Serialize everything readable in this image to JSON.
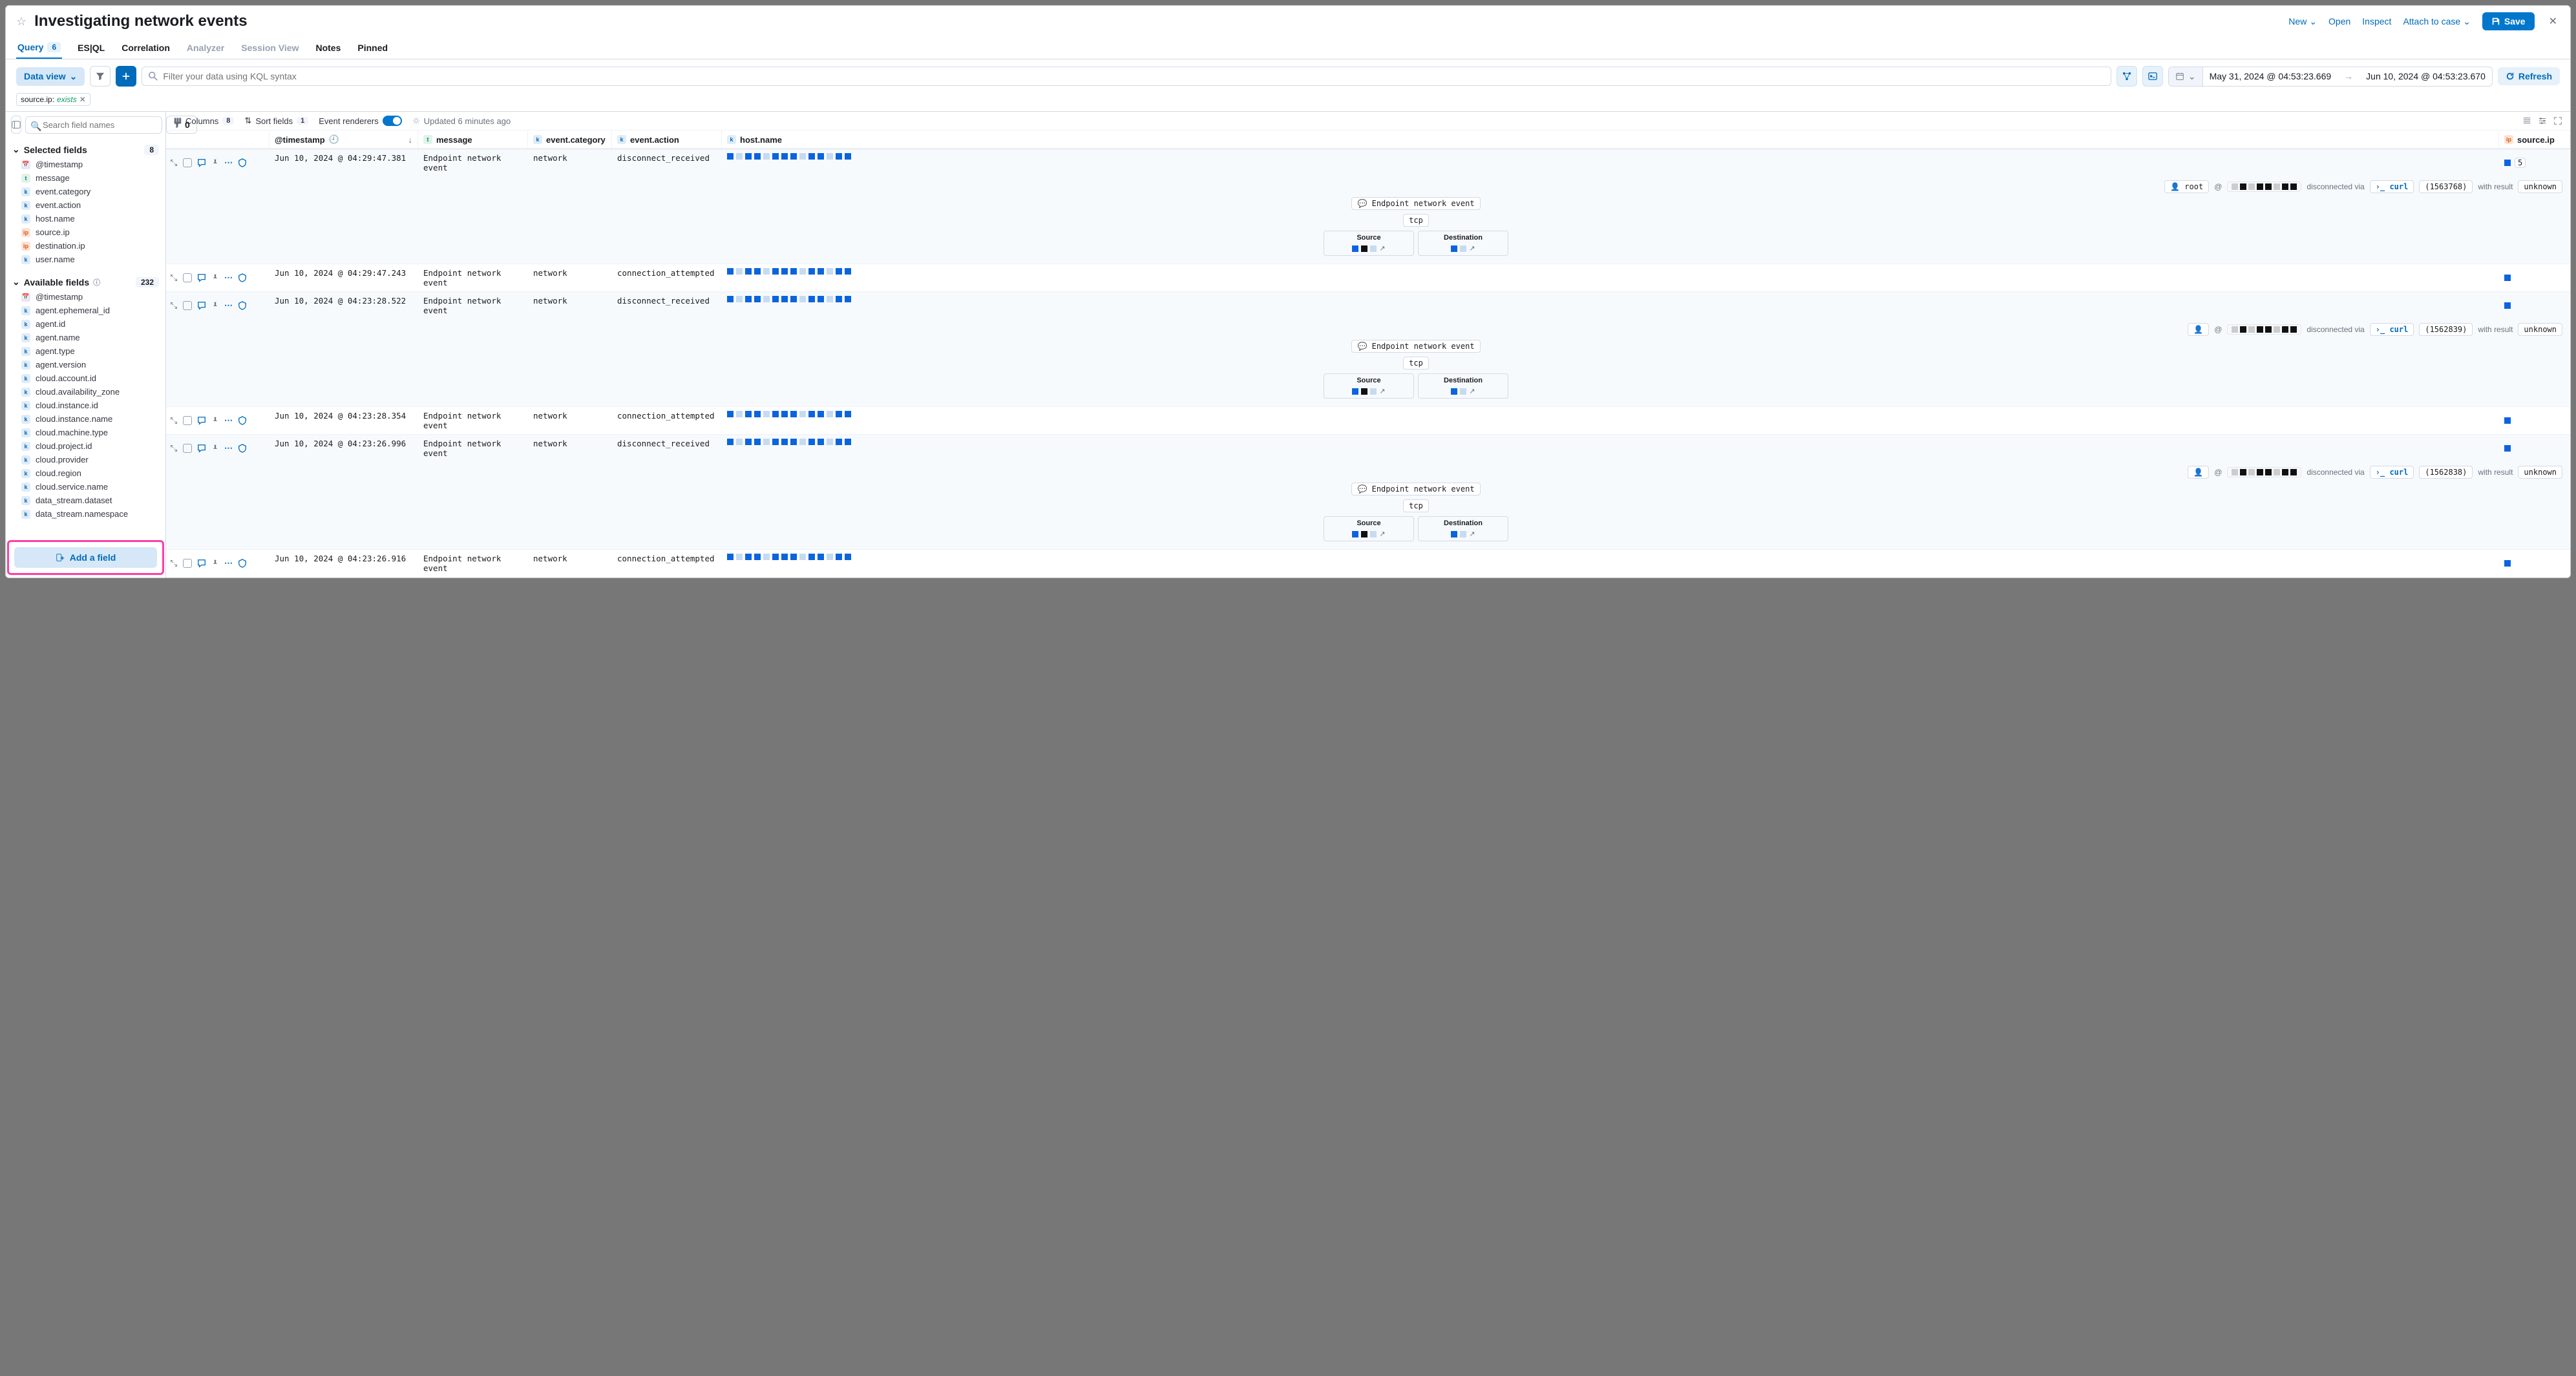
{
  "header": {
    "title": "Investigating network events",
    "actions": {
      "new": "New",
      "open": "Open",
      "inspect": "Inspect",
      "attach": "Attach to case",
      "save": "Save"
    }
  },
  "tabs": {
    "query": "Query",
    "query_badge": "6",
    "esql": "ES|QL",
    "correlation": "Correlation",
    "analyzer": "Analyzer",
    "session": "Session View",
    "notes": "Notes",
    "pinned": "Pinned"
  },
  "querybar": {
    "dataview": "Data view",
    "placeholder": "Filter your data using KQL syntax",
    "date_from": "May 31, 2024 @ 04:53:23.669",
    "date_to": "Jun 10, 2024 @ 04:53:23.670",
    "refresh": "Refresh"
  },
  "filter": {
    "field": "source.ip:",
    "value": "exists"
  },
  "sidebar": {
    "search_placeholder": "Search field names",
    "filter_count": "0",
    "selected_label": "Selected fields",
    "selected_count": "8",
    "selected": [
      {
        "type": "cal",
        "name": "@timestamp"
      },
      {
        "type": "t",
        "name": "message"
      },
      {
        "type": "k",
        "name": "event.category"
      },
      {
        "type": "k",
        "name": "event.action"
      },
      {
        "type": "k",
        "name": "host.name"
      },
      {
        "type": "ip",
        "name": "source.ip"
      },
      {
        "type": "ip",
        "name": "destination.ip"
      },
      {
        "type": "k",
        "name": "user.name"
      }
    ],
    "available_label": "Available fields",
    "available_count": "232",
    "available": [
      {
        "type": "cal",
        "name": "@timestamp"
      },
      {
        "type": "k",
        "name": "agent.ephemeral_id"
      },
      {
        "type": "k",
        "name": "agent.id"
      },
      {
        "type": "k",
        "name": "agent.name"
      },
      {
        "type": "k",
        "name": "agent.type"
      },
      {
        "type": "k",
        "name": "agent.version"
      },
      {
        "type": "k",
        "name": "cloud.account.id"
      },
      {
        "type": "k",
        "name": "cloud.availability_zone"
      },
      {
        "type": "k",
        "name": "cloud.instance.id"
      },
      {
        "type": "k",
        "name": "cloud.instance.name"
      },
      {
        "type": "k",
        "name": "cloud.machine.type"
      },
      {
        "type": "k",
        "name": "cloud.project.id"
      },
      {
        "type": "k",
        "name": "cloud.provider"
      },
      {
        "type": "k",
        "name": "cloud.region"
      },
      {
        "type": "k",
        "name": "cloud.service.name"
      },
      {
        "type": "k",
        "name": "data_stream.dataset"
      },
      {
        "type": "k",
        "name": "data_stream.namespace"
      }
    ],
    "add_field": "Add a field"
  },
  "toolbar": {
    "columns": "Columns",
    "columns_count": "8",
    "sort": "Sort fields",
    "sort_count": "1",
    "renderers": "Event renderers",
    "updated": "Updated 6 minutes ago"
  },
  "columns": {
    "timestamp": "@timestamp",
    "message": "message",
    "category": "event.category",
    "action": "event.action",
    "host": "host.name",
    "source": "source.ip"
  },
  "rows": [
    {
      "ts": "Jun 10, 2024 @ 04:29:47.381",
      "msg": "Endpoint network event",
      "cat": "network",
      "act": "disconnect_received",
      "expanded": true,
      "src_badge": "5",
      "user": "root",
      "via": "disconnected via",
      "proc": "curl",
      "pid": "(1563768)",
      "with": "with result",
      "result": "unknown",
      "evlabel": "Endpoint network event",
      "proto": "tcp",
      "src": "Source",
      "dst": "Destination"
    },
    {
      "ts": "Jun 10, 2024 @ 04:29:47.243",
      "msg": "Endpoint network event",
      "cat": "network",
      "act": "connection_attempted",
      "expanded": false
    },
    {
      "ts": "Jun 10, 2024 @ 04:23:28.522",
      "msg": "Endpoint network event",
      "cat": "network",
      "act": "disconnect_received",
      "expanded": true,
      "user": "",
      "via": "disconnected via",
      "proc": "curl",
      "pid": "(1562839)",
      "with": "with result",
      "result": "unknown",
      "evlabel": "Endpoint network event",
      "proto": "tcp",
      "src": "Source",
      "dst": "Destination"
    },
    {
      "ts": "Jun 10, 2024 @ 04:23:28.354",
      "msg": "Endpoint network event",
      "cat": "network",
      "act": "connection_attempted",
      "expanded": false
    },
    {
      "ts": "Jun 10, 2024 @ 04:23:26.996",
      "msg": "Endpoint network event",
      "cat": "network",
      "act": "disconnect_received",
      "expanded": true,
      "user": "",
      "via": "disconnected via",
      "proc": "curl",
      "pid": "(1562838)",
      "with": "with result",
      "result": "unknown",
      "evlabel": "Endpoint network event",
      "proto": "tcp",
      "src": "Source",
      "dst": "Destination"
    },
    {
      "ts": "Jun 10, 2024 @ 04:23:26.916",
      "msg": "Endpoint network event",
      "cat": "network",
      "act": "connection_attempted",
      "expanded": false
    }
  ]
}
